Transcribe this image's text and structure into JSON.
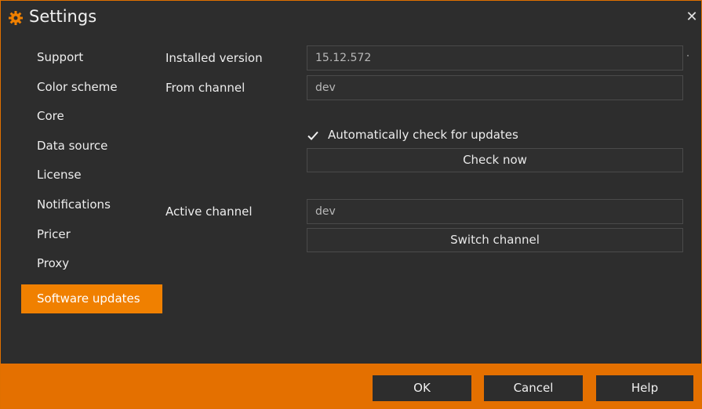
{
  "window": {
    "title": "Settings"
  },
  "sidebar": {
    "items": [
      {
        "label": "Support"
      },
      {
        "label": "Color scheme"
      },
      {
        "label": "Core"
      },
      {
        "label": "Data source"
      },
      {
        "label": "License"
      },
      {
        "label": "Notifications"
      },
      {
        "label": "Pricer"
      },
      {
        "label": "Proxy"
      },
      {
        "label": "Software updates",
        "active": true
      }
    ]
  },
  "updates": {
    "installed_version_label": "Installed version",
    "installed_version_value": "15.12.572",
    "from_channel_label": "From channel",
    "from_channel_value": "dev",
    "auto_check_label": "Automatically check for updates",
    "auto_check_checked": true,
    "check_now_label": "Check now",
    "active_channel_label": "Active channel",
    "active_channel_value": "dev",
    "switch_channel_label": "Switch channel"
  },
  "footer": {
    "ok_label": "OK",
    "cancel_label": "Cancel",
    "help_label": "Help"
  },
  "colors": {
    "accent": "#f08000",
    "footer": "#e47000",
    "background": "#2d2d2d"
  },
  "icons": {
    "title": "gear-icon",
    "close": "close-icon",
    "checkbox": "checkmark-icon"
  }
}
